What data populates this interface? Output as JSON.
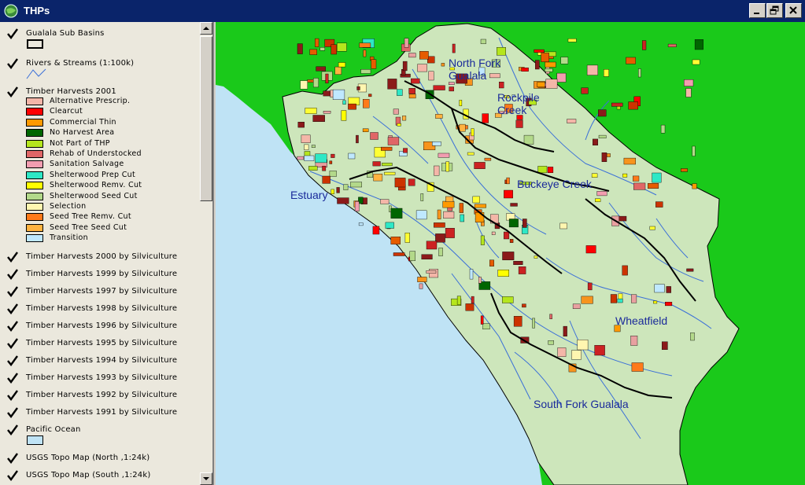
{
  "window": {
    "title": "THPs",
    "buttons": {
      "minimize": "minimize",
      "restore": "restore",
      "close": "close"
    }
  },
  "toc": {
    "layers": [
      {
        "name": "Gualala Sub Basins",
        "checked": true,
        "symbol": "polygon-outline"
      },
      {
        "name": "Rivers & Streams (1:100k)",
        "checked": true,
        "symbol": "line"
      },
      {
        "name": "Timber Harvests 2001",
        "checked": true,
        "symbol": "legend"
      },
      {
        "name": "Timber Harvests 2000 by Silviculture",
        "checked": true
      },
      {
        "name": "Timber Harvests 1999 by Silviculture",
        "checked": true
      },
      {
        "name": "Timber Harvests 1997 by Silviculture",
        "checked": true
      },
      {
        "name": "Timber Harvests 1998 by Silviculture",
        "checked": true
      },
      {
        "name": "Timber Harvests 1996 by Silviculture",
        "checked": true
      },
      {
        "name": "Timber Harvests 1995 by Silviculture",
        "checked": true
      },
      {
        "name": "Timber Harvests 1994 by Silviculture",
        "checked": true
      },
      {
        "name": "Timber Harvests 1993 by Silviculture",
        "checked": true
      },
      {
        "name": "Timber Harvests 1992 by Silviculture",
        "checked": true
      },
      {
        "name": "Timber Harvests 1991 by Silviculture",
        "checked": true
      },
      {
        "name": "Pacific Ocean",
        "checked": true,
        "symbol": "polygon-fill"
      },
      {
        "name": "USGS Topo Map (North ,1:24k)",
        "checked": true
      },
      {
        "name": "USGS Topo Map (South ,1:24k)",
        "checked": true
      }
    ],
    "timber_2001_legend": [
      {
        "label": "Alternative Prescrip.",
        "color": "#f4b6a8"
      },
      {
        "label": "Clearcut",
        "color": "#ff0000"
      },
      {
        "label": "Commercial Thin",
        "color": "#ff9900"
      },
      {
        "label": "No Harvest Area",
        "color": "#006600"
      },
      {
        "label": "Not Part of THP",
        "color": "#b5e61d"
      },
      {
        "label": "Rehab of Understocked",
        "color": "#e06666"
      },
      {
        "label": "Sanitation Salvage",
        "color": "#f29db0"
      },
      {
        "label": "Shelterwood Prep Cut",
        "color": "#2ee8c6"
      },
      {
        "label": "Shelterwood Remv. Cut",
        "color": "#ffff00"
      },
      {
        "label": "Shelterwood Seed Cut",
        "color": "#b3d98a"
      },
      {
        "label": "Selection",
        "color": "#fff6b0"
      },
      {
        "label": "Seed Tree Remv. Cut",
        "color": "#ff7a1a"
      },
      {
        "label": "Seed Tree Seed Cut",
        "color": "#ffb340"
      },
      {
        "label": "Transition",
        "color": "#bfe8ff"
      }
    ],
    "pacific_ocean_color": "#bfe3f5"
  },
  "map": {
    "labels": {
      "north_fork": "North Fork\nGualala",
      "rockpile": "Rockpile\nCreek",
      "buckeye": "Buckeye Creek",
      "estuary": "Estuary",
      "wheatfield": "Wheatfield",
      "south_fork": "South Fork Gualala"
    },
    "colors": {
      "background": "#1ac91a",
      "ocean": "#bfe3f5",
      "land": "#cfe8c0",
      "stream": "#3a6fd8",
      "boundary": "#000000"
    }
  }
}
